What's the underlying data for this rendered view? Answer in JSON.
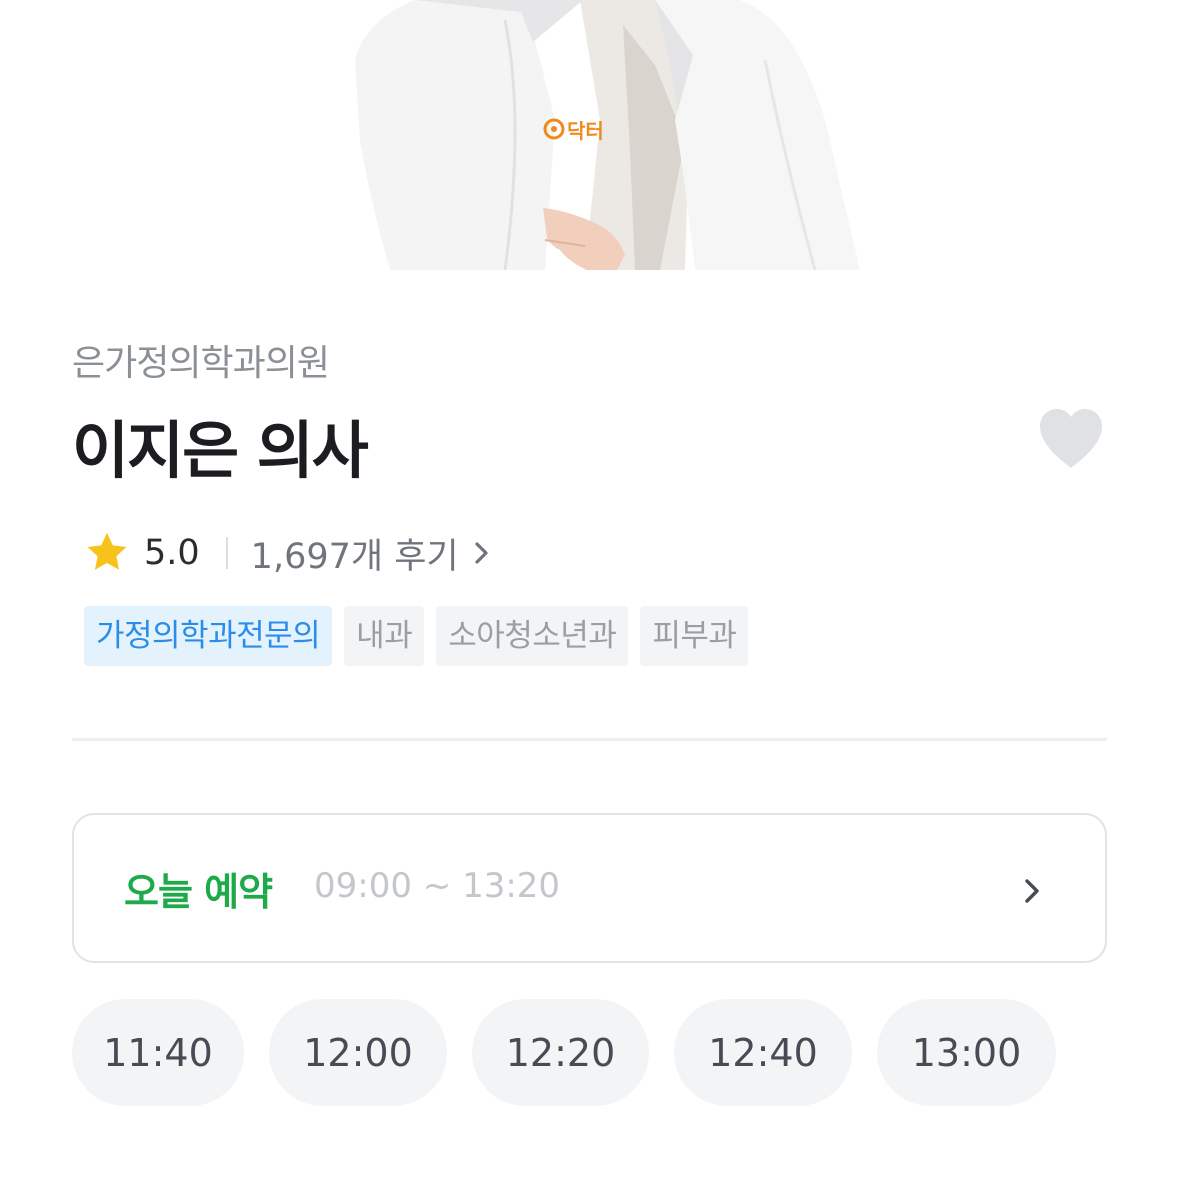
{
  "doctor": {
    "hospital": "은가정의학과의원",
    "name": "이지은 의사",
    "photo_badge_text": "닥터"
  },
  "rating": {
    "score": "5.0",
    "reviews": "1,697개 후기"
  },
  "tags": [
    {
      "label": "가정의학과전문의",
      "style": "primary"
    },
    {
      "label": "내과",
      "style": "secondary"
    },
    {
      "label": "소아청소년과",
      "style": "secondary"
    },
    {
      "label": "피부과",
      "style": "secondary"
    }
  ],
  "booking": {
    "title": "오늘 예약",
    "hours": "09:00 ~ 13:20"
  },
  "slots": [
    "11:40",
    "12:00",
    "12:20",
    "12:40",
    "13:00"
  ],
  "icons": {
    "favorite": "heart-icon",
    "star": "star-icon",
    "review_link": "chevron-right-icon",
    "booking_link": "chevron-right-icon"
  },
  "colors": {
    "booking_title": "#1faa4a",
    "primary_tag_bg": "#e4f2fe",
    "primary_tag_text": "#2a8ee8",
    "star": "#f7c21c",
    "heart": "#dfe1e4"
  }
}
